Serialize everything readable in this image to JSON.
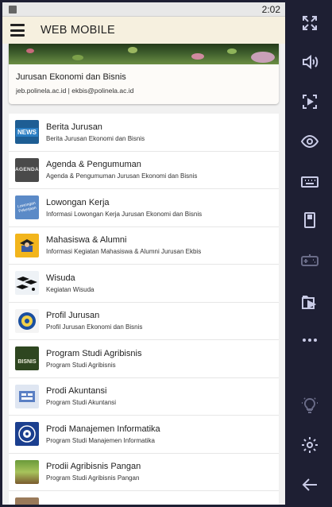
{
  "status_bar": {
    "time": "2:02"
  },
  "app_bar": {
    "title": "WEB MOBILE"
  },
  "header": {
    "department": "Jurusan Ekonomi dan Bisnis",
    "contact": "jeb.polinela.ac.id | ekbis@polinela.ac.id"
  },
  "menu": [
    {
      "title": "Berita Jurusan",
      "subtitle": "Berita Jurusan Ekonomi dan Bisnis",
      "icon": "news-icon",
      "icon_text": "NEWS"
    },
    {
      "title": "Agenda & Pengumuman",
      "subtitle": "Agenda & Pengumuman Jurusan Ekonomi dan Bisnis",
      "icon": "agenda-icon",
      "icon_text": "AGENDA"
    },
    {
      "title": "Lowongan Kerja",
      "subtitle": "Informasi Lowongan Kerja Jurusan Ekonomi dan Bisnis",
      "icon": "job-vacancy-icon",
      "icon_text": "Lowongan Pekerjaan"
    },
    {
      "title": "Mahasiswa & Alumni",
      "subtitle": "Informasi Kegiatan Mahasiswa & Alumni Jurusan Ekbis",
      "icon": "student-alumni-icon"
    },
    {
      "title": "Wisuda",
      "subtitle": "Kegiatan Wisuda",
      "icon": "graduation-icon"
    },
    {
      "title": "Profil Jurusan",
      "subtitle": "Profil Jurusan Ekonomi dan Bisnis",
      "icon": "department-logo-icon"
    },
    {
      "title": "Program Studi Agribisnis",
      "subtitle": "Program Studi Agribisnis",
      "icon": "agribusiness-icon",
      "icon_text": "BISNIS"
    },
    {
      "title": "Prodi Akuntansi",
      "subtitle": "Program Studi Akuntansi",
      "icon": "accounting-icon"
    },
    {
      "title": "Prodi Manajemen Informatika",
      "subtitle": "Program Studi Manajemen Informatika",
      "icon": "informatics-icon"
    },
    {
      "title": "Prodii Agribisnis Pangan",
      "subtitle": "Program Studi Agribisnis Pangan",
      "icon": "food-agribusiness-icon"
    }
  ],
  "sidebar": [
    {
      "name": "fullscreen-icon"
    },
    {
      "name": "volume-icon"
    },
    {
      "name": "screenshot-icon"
    },
    {
      "name": "eye-icon"
    },
    {
      "name": "keyboard-icon"
    },
    {
      "name": "phone-rotate-icon"
    },
    {
      "name": "gamepad-icon"
    },
    {
      "name": "media-folder-icon"
    },
    {
      "name": "more-icon"
    },
    {
      "name": "light-bulb-icon"
    },
    {
      "name": "settings-icon"
    },
    {
      "name": "back-arrow-icon"
    }
  ]
}
